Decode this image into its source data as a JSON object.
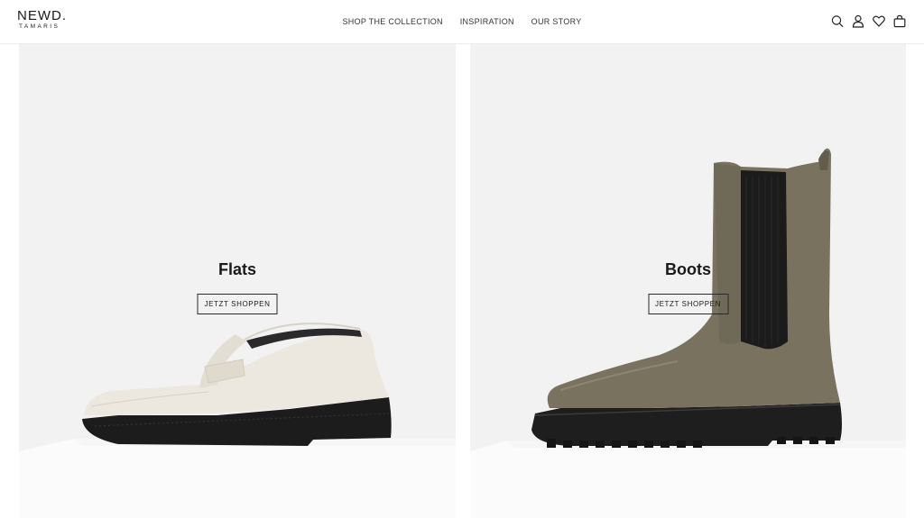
{
  "header": {
    "logo_main": "NEWD.",
    "logo_sub": "TAMARIS",
    "nav": [
      {
        "label": "SHOP THE COLLECTION"
      },
      {
        "label": "INSPIRATION"
      },
      {
        "label": "OUR STORY"
      }
    ],
    "icons": [
      "search-icon",
      "account-icon",
      "wishlist-icon",
      "cart-icon"
    ]
  },
  "tiles": [
    {
      "title": "Flats",
      "cta": "JETZT SHOPPEN",
      "image": "white-loafer"
    },
    {
      "title": "Boots",
      "cta": "JETZT SHOPPEN",
      "image": "olive-chelsea-boot"
    }
  ],
  "colors": {
    "background": "#ffffff",
    "tile_background": "#f2f2f2",
    "pedestal": "#fbfbfb",
    "loafer": "#ece8df",
    "boot": "#78725f",
    "sole": "#1c1c1c"
  }
}
